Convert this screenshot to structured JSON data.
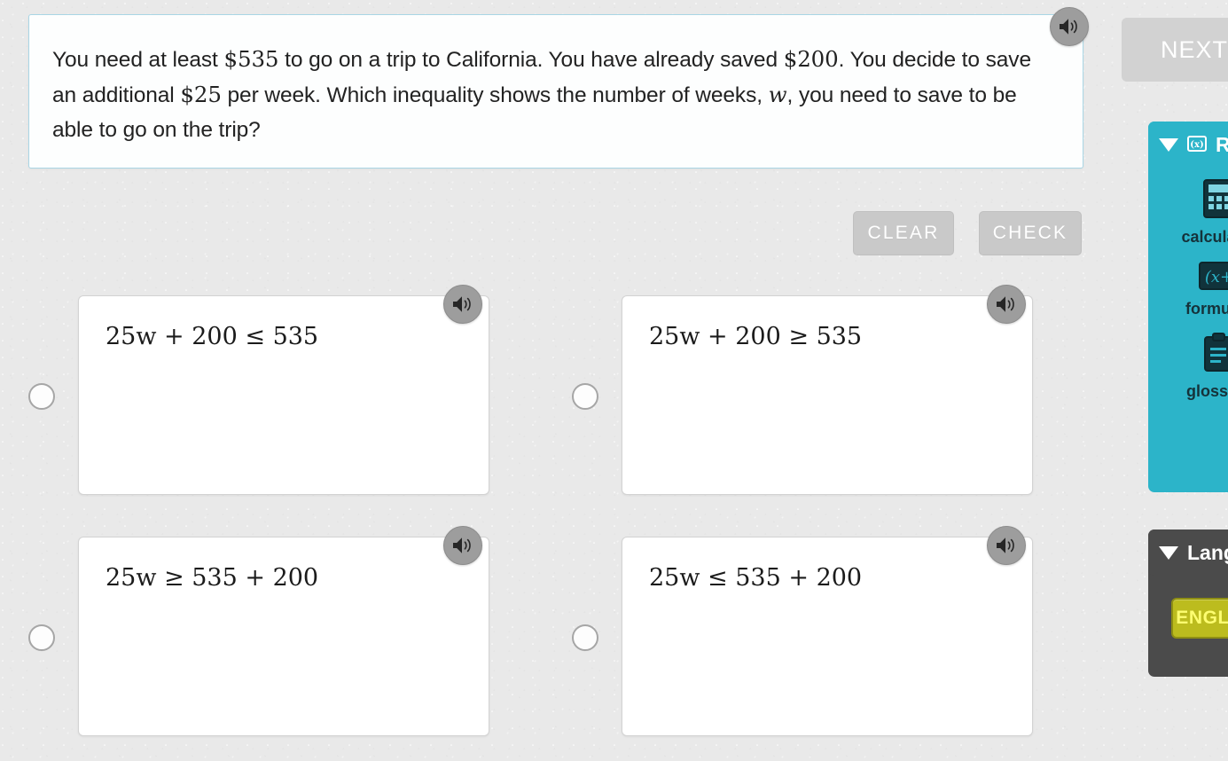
{
  "question": {
    "segments": [
      {
        "t": "You need at least ",
        "k": "plain"
      },
      {
        "t": "$535",
        "k": "math"
      },
      {
        "t": " to go on a trip to California. You have already saved ",
        "k": "plain"
      },
      {
        "t": "$200",
        "k": "math"
      },
      {
        "t": ". You decide to save an additional ",
        "k": "plain"
      },
      {
        "t": "$25",
        "k": "math"
      },
      {
        "t": " per week. Which inequality shows the number of weeks, ",
        "k": "plain"
      },
      {
        "t": "w",
        "k": "var"
      },
      {
        "t": ", you need to save to be able to go on the trip?",
        "k": "plain"
      }
    ],
    "full_text": "You need at least $535 to go on a trip to California. You have already saved $200. You decide to save an additional $25 per week. Which inequality shows the number of weeks, w, you need to save to be able to go on the trip?",
    "speaker_icon": "speaker-icon"
  },
  "toolbar": {
    "clear_label": "CLEAR",
    "check_label": "CHECK"
  },
  "choices": [
    {
      "id": "a",
      "math": "25w + 200 ≤ 535",
      "selected": false,
      "speaker_icon": "speaker-icon"
    },
    {
      "id": "b",
      "math": "25w + 200 ≥ 535",
      "selected": false,
      "speaker_icon": "speaker-icon"
    },
    {
      "id": "c",
      "math": "25w ≥ 535 + 200",
      "selected": false,
      "speaker_icon": "speaker-icon"
    },
    {
      "id": "d",
      "math": "25w ≤ 535 + 200",
      "selected": false,
      "speaker_icon": "speaker-icon"
    }
  ],
  "rail": {
    "next_label": "NEXT",
    "reference": {
      "title": "Reference",
      "title_icon": "formula-box-icon",
      "caret_icon": "chevron-down-icon",
      "tools": [
        {
          "label": "calculator",
          "icon": "calculator-icon"
        },
        {
          "label": "formulas",
          "icon": "formula-box-icon"
        },
        {
          "label": "glossary",
          "icon": "clipboard-icon"
        }
      ]
    },
    "language": {
      "title": "Language",
      "caret_icon": "chevron-down-icon",
      "selected": "ENGLISH"
    }
  },
  "colors": {
    "accent_teal": "#2cb4c9",
    "panel_dark": "#4b4b4b",
    "lang_yellow": "#bcbc1e",
    "lang_yellow_text": "#fdfd71",
    "question_border": "#a9d6e5",
    "page_bg": "#e9e9e9",
    "button_gray": "#c9c9c9"
  }
}
